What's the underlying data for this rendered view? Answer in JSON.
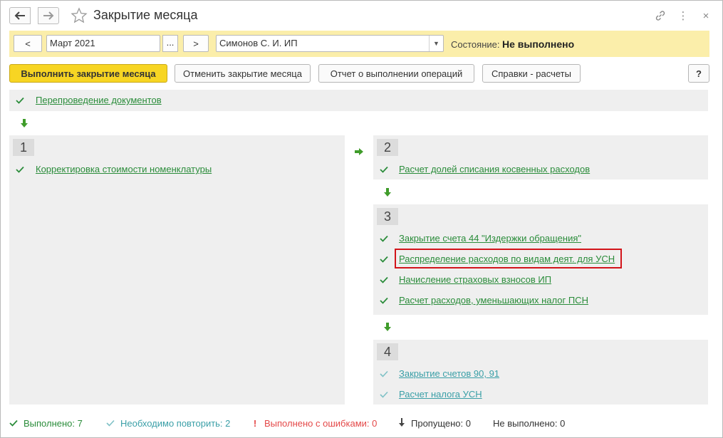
{
  "window": {
    "title": "Закрытие месяца",
    "nav": {
      "back_icon": "arrow-left-icon",
      "forward_icon": "arrow-right-icon",
      "favorite_icon": "star-icon"
    },
    "tools": {
      "link_icon": "link-icon",
      "more_icon": "more-vertical-icon",
      "close_icon": "close-icon",
      "more_glyph": "⋮",
      "close_glyph": "×"
    }
  },
  "filter": {
    "prev_label": "<",
    "period_value": "Март 2021",
    "period_picker_label": "...",
    "next_label": ">",
    "org_value": "Симонов С. И. ИП",
    "state_label": "Состояние:",
    "state_value": "Не выполнено"
  },
  "toolbar": {
    "run_label": "Выполнить закрытие месяца",
    "cancel_label": "Отменить закрытие месяца",
    "report_label": "Отчет о выполнении операций",
    "references_label": "Справки - расчеты",
    "help_label": "?"
  },
  "pre_step": {
    "label": "Перепроведение документов",
    "status": "done"
  },
  "steps": [
    {
      "number": "1",
      "items": [
        {
          "label": "Корректировка стоимости номенклатуры",
          "status": "done"
        }
      ]
    },
    {
      "number": "2",
      "items": [
        {
          "label": "Расчет долей списания косвенных расходов",
          "status": "done"
        }
      ]
    },
    {
      "number": "3",
      "items": [
        {
          "label": "Закрытие счета 44 \"Издержки обращения\"",
          "status": "done"
        },
        {
          "label": "Распределение расходов по видам деят. для УСН",
          "status": "done",
          "highlighted": true
        },
        {
          "label": "Начисление страховых взносов ИП",
          "status": "done"
        },
        {
          "label": "Расчет расходов, уменьшающих налог ПСН",
          "status": "done"
        }
      ]
    },
    {
      "number": "4",
      "items": [
        {
          "label": "Закрытие счетов 90, 91",
          "status": "repeat"
        },
        {
          "label": "Расчет налога УСН",
          "status": "repeat"
        }
      ]
    }
  ],
  "status_bar": {
    "done": {
      "label": "Выполнено:",
      "count": "7",
      "icon": "check-icon"
    },
    "repeat": {
      "label": "Необходимо повторить:",
      "count": "2",
      "icon": "check-icon"
    },
    "errors": {
      "label": "Выполнено с ошибками:",
      "count": "0",
      "icon": "exclamation-icon",
      "glyph": "!"
    },
    "skipped": {
      "label": "Пропущено:",
      "count": "0",
      "icon": "arrow-down-icon"
    },
    "not_done": {
      "label": "Не выполнено:",
      "count": "0"
    }
  },
  "colors": {
    "accent_yellow": "#f7d523",
    "filter_bg": "#fbeeaa",
    "done_green": "#2a8c3a",
    "repeat_teal": "#3a9fa7",
    "error_red": "#e44848",
    "highlight_red": "#d2141a"
  }
}
